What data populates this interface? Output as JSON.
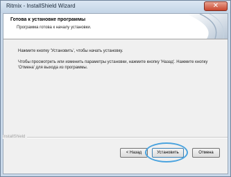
{
  "window": {
    "title": "Ritmix - InstallShield Wizard",
    "close_icon": "close-icon"
  },
  "banner": {
    "heading": "Готова к установке программы",
    "subheading": "Программа готова к началу установки."
  },
  "body": {
    "line1": "Нажмите кнопку 'Установить', чтобы начать установку.",
    "line2": "Чтобы просмотреть или изменить параметры установки, нажмите кнопку 'Назад'. Нажмите кнопку 'Отмена' для выхода из программы."
  },
  "footer": {
    "brand": "InstallShield"
  },
  "buttons": {
    "back": "< Назад",
    "install": "Установить",
    "cancel": "Отмена"
  },
  "colors": {
    "highlight": "#4aa3df",
    "close_button": "#c8462e"
  }
}
